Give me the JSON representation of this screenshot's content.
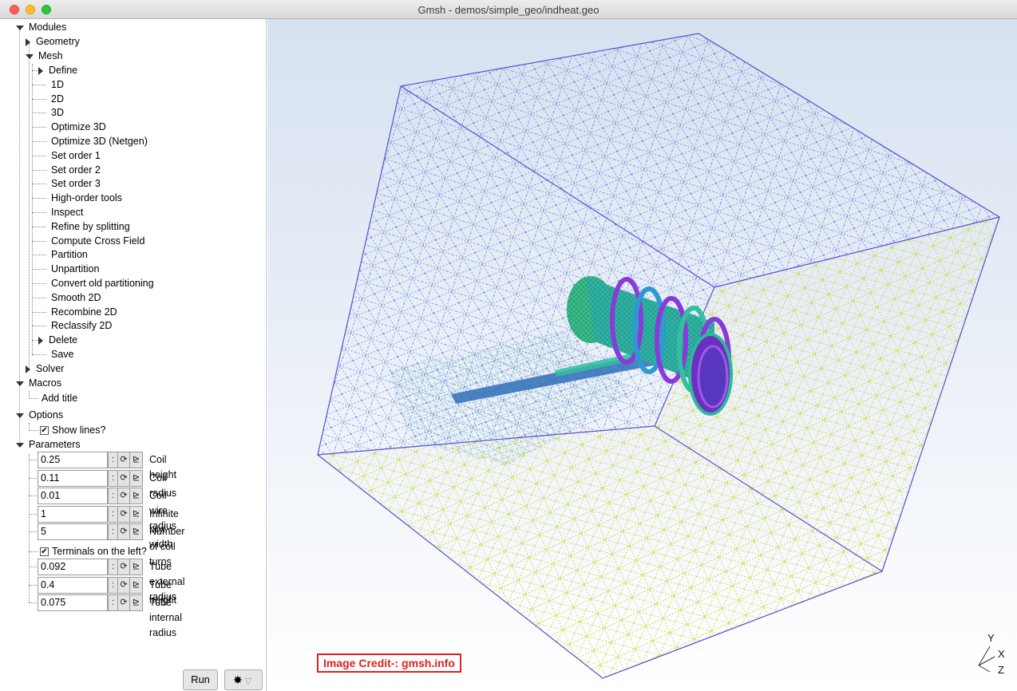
{
  "window": {
    "title": "Gmsh - demos/simple_geo/indheat.geo"
  },
  "tree": {
    "modules": "Modules",
    "geometry": "Geometry",
    "mesh": "Mesh",
    "mesh_items": [
      "Define",
      "1D",
      "2D",
      "3D",
      "Optimize 3D",
      "Optimize 3D (Netgen)",
      "Set order 1",
      "Set order 2",
      "Set order 3",
      "High-order tools",
      "Inspect",
      "Refine by splitting",
      "Compute Cross Field",
      "Partition",
      "Unpartition",
      "Convert old partitioning",
      "Smooth 2D",
      "Recombine 2D",
      "Reclassify 2D",
      "Delete",
      "Save"
    ],
    "solver": "Solver",
    "macros": "Macros",
    "add_title": "Add title",
    "options": "Options",
    "show_lines": "Show lines?",
    "parameters": "Parameters"
  },
  "params": [
    {
      "value": "0.25",
      "label": "Coil height"
    },
    {
      "value": "0.11",
      "label": "Coil radius"
    },
    {
      "value": "0.01",
      "label": "Coil wire radius"
    },
    {
      "value": "1",
      "label": "Infinite box width"
    },
    {
      "value": "5",
      "label": "Number of coil turns"
    }
  ],
  "terminals_label": "Terminals on the left?",
  "params2": [
    {
      "value": "0.092",
      "label": "Tube external radius"
    },
    {
      "value": "0.4",
      "label": "Tube height"
    },
    {
      "value": "0.075",
      "label": "Tube internal radius"
    }
  ],
  "buttons": {
    "run": "Run",
    "colon": ":",
    "loop_icon": "⟳",
    "graph_icon": "⊵",
    "settings_icon": "✸",
    "dropdown": "▽"
  },
  "axes": {
    "y": "Y",
    "x": "X",
    "z": "Z"
  },
  "credit": "Image Credit-: gmsh.info",
  "colors": {
    "cube_edge": "#5a4fd0",
    "mesh_blue": "#4a6fd8",
    "mesh_yellow": "#c9d23a",
    "coil_green": "#39c27a",
    "coil_purple": "#8a3ad8"
  }
}
